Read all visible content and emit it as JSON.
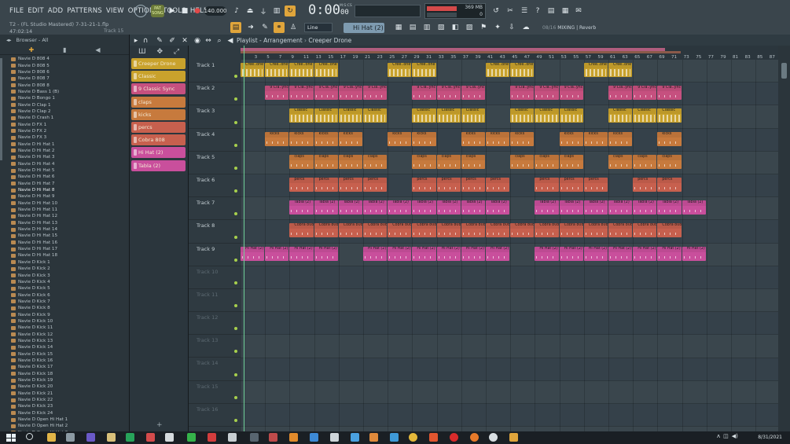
{
  "menu": [
    "FILE",
    "EDIT",
    "ADD",
    "PATTERNS",
    "VIEW",
    "OPTIONS",
    "TOOLS",
    "HELP"
  ],
  "song": {
    "title": "T2 - (FL Studio Mastered) 7-31-21-1.flp",
    "time": "47:02:14",
    "track": "Track 15"
  },
  "transport": {
    "pattern_song": [
      "PAT",
      "SONG"
    ],
    "tempo": "140.000",
    "time_main": "0:00",
    "time_frac": "00",
    "time_mode": "M:S:CS"
  },
  "cpu": {
    "ram": "369 MB",
    "poly": "0"
  },
  "toolbar": {
    "snap": "Line",
    "pattern": "Hi Hat (2)",
    "mixer_slot": "08/16",
    "mixer_label": "MIXING | Reverb"
  },
  "browser": {
    "title": "Browser - All",
    "files": [
      "Navie D 808 4",
      "Navie D 808 5",
      "Navie D 808 6",
      "Navie D 808 7",
      "Navie D 808 8",
      "Navie D Bass 1 (B)",
      "Navie D Bongo 1",
      "Navie D Clap 1",
      "Navie D Clap 2",
      "Navie D Crash 1",
      "Navie D FX 1",
      "Navie D FX 2",
      "Navie D FX 3",
      "Navie D Hi Hat 1",
      "Navie D Hi Hat 2",
      "Navie D Hi Hat 3",
      "Navie D Hi Hat 4",
      "Navie D Hi Hat 5",
      "Navie D Hi Hat 6",
      "Navie D Hi Hat 7",
      "Navie D Hi Hat 8",
      "Navie D Hi Hat 9",
      "Navie D Hi Hat 10",
      "Navie D Hi Hat 11",
      "Navie D Hi Hat 12",
      "Navie D Hi Hat 13",
      "Navie D Hi Hat 14",
      "Navie D Hi Hat 15",
      "Navie D Hi Hat 16",
      "Navie D Hi Hat 17",
      "Navie D Hi Hat 18",
      "Navie D Kick 1",
      "Navie D Kick 2",
      "Navie D Kick 3",
      "Navie D Kick 4",
      "Navie D Kick 5",
      "Navie D Kick 6",
      "Navie D Kick 7",
      "Navie D Kick 8",
      "Navie D Kick 9",
      "Navie D Kick 10",
      "Navie D Kick 11",
      "Navie D Kick 12",
      "Navie D Kick 13",
      "Navie D Kick 14",
      "Navie D Kick 15",
      "Navie D Kick 16",
      "Navie D Kick 17",
      "Navie D Kick 18",
      "Navie D Kick 19",
      "Navie D Kick 20",
      "Navie D Kick 21",
      "Navie D Kick 22",
      "Navie D Kick 23",
      "Navie D Kick 24",
      "Navie D Open Hi Hat 1",
      "Navie D Open Hi Hat 2",
      "Navie D Open Hi Hat 3"
    ],
    "selected": "Navie D Hi Hat 8"
  },
  "playlist": {
    "title": "Playlist - Arrangement",
    "current_pattern": "Creeper Drone",
    "patterns": [
      {
        "name": "Creeper Drone",
        "color": "#c9a22c"
      },
      {
        "name": "Classic",
        "color": "#c9a22c"
      },
      {
        "name": "9 Classic Sync",
        "color": "#c6507f"
      },
      {
        "name": "claps",
        "color": "#c77a3d"
      },
      {
        "name": "kicks",
        "color": "#c77a3d"
      },
      {
        "name": "percs",
        "color": "#c7604e"
      },
      {
        "name": "Cobra 808",
        "color": "#c7604e"
      },
      {
        "name": "Hi Hat (2)",
        "color": "#c94f9c"
      },
      {
        "name": "Tabla (2)",
        "color": "#c94f9c"
      }
    ],
    "tracks": [
      "Track 1",
      "Track 2",
      "Track 3",
      "Track 4",
      "Track 5",
      "Track 6",
      "Track 7",
      "Track 8",
      "Track 9",
      "Track 10",
      "Track 11",
      "Track 12",
      "Track 13",
      "Track 14",
      "Track 15",
      "Track 16"
    ],
    "ruler": [
      "3",
      "5",
      "7",
      "9",
      "11",
      "13",
      "15",
      "17",
      "19",
      "21",
      "23",
      "25",
      "27",
      "29",
      "31",
      "33",
      "35",
      "37",
      "39",
      "41",
      "43",
      "45",
      "47",
      "49",
      "51",
      "53",
      "55",
      "57",
      "59",
      "61",
      "63",
      "65",
      "67",
      "69",
      "71",
      "73",
      "75",
      "77",
      "79",
      "81",
      "83",
      "85",
      "87"
    ],
    "lanes": [
      {
        "label": "Cree..one",
        "color": "#c9a22c",
        "bars": [
          [
            1,
            4
          ],
          [
            5,
            8
          ],
          [
            9,
            12
          ],
          [
            13,
            16
          ],
          [
            25,
            28
          ],
          [
            29,
            32
          ],
          [
            41,
            44
          ],
          [
            45,
            48
          ],
          [
            57,
            60
          ],
          [
            61,
            64
          ]
        ]
      },
      {
        "label": "9 Cla..ync",
        "color": "#c6507f",
        "bars": [
          [
            5,
            8
          ],
          [
            9,
            12
          ],
          [
            13,
            16
          ],
          [
            17,
            20
          ],
          [
            21,
            24
          ],
          [
            29,
            32
          ],
          [
            33,
            36
          ],
          [
            37,
            40
          ],
          [
            45,
            48
          ],
          [
            49,
            52
          ],
          [
            53,
            56
          ],
          [
            61,
            64
          ],
          [
            65,
            68
          ],
          [
            69,
            72
          ]
        ]
      },
      {
        "label": "Classic",
        "color": "#c9a22c",
        "bars": [
          [
            9,
            12
          ],
          [
            13,
            16
          ],
          [
            17,
            20
          ],
          [
            21,
            24
          ],
          [
            29,
            32
          ],
          [
            33,
            36
          ],
          [
            37,
            40
          ],
          [
            45,
            48
          ],
          [
            49,
            52
          ],
          [
            53,
            56
          ],
          [
            61,
            64
          ],
          [
            65,
            68
          ],
          [
            69,
            72
          ]
        ]
      },
      {
        "label": "kicks",
        "color": "#c77a3d",
        "bars": [
          [
            5,
            8
          ],
          [
            9,
            12
          ],
          [
            13,
            16
          ],
          [
            17,
            20
          ],
          [
            25,
            28
          ],
          [
            29,
            32
          ],
          [
            37,
            40
          ],
          [
            41,
            44
          ],
          [
            45,
            48
          ],
          [
            53,
            56
          ],
          [
            57,
            60
          ],
          [
            61,
            64
          ],
          [
            69,
            72
          ]
        ]
      },
      {
        "label": "claps",
        "color": "#c77a3d",
        "bars": [
          [
            9,
            12
          ],
          [
            13,
            16
          ],
          [
            17,
            20
          ],
          [
            21,
            24
          ],
          [
            29,
            32
          ],
          [
            33,
            36
          ],
          [
            37,
            40
          ],
          [
            45,
            48
          ],
          [
            49,
            52
          ],
          [
            53,
            56
          ],
          [
            61,
            64
          ],
          [
            65,
            68
          ],
          [
            69,
            72
          ]
        ]
      },
      {
        "label": "percs",
        "color": "#c7604e",
        "bars": [
          [
            9,
            12
          ],
          [
            13,
            16
          ],
          [
            17,
            20
          ],
          [
            21,
            24
          ],
          [
            29,
            32
          ],
          [
            33,
            36
          ],
          [
            37,
            40
          ],
          [
            41,
            44
          ],
          [
            49,
            52
          ],
          [
            53,
            56
          ],
          [
            57,
            60
          ],
          [
            65,
            68
          ],
          [
            69,
            72
          ]
        ]
      },
      {
        "label": "Tabla (2)",
        "color": "#c94f9c",
        "bars": [
          [
            9,
            12
          ],
          [
            13,
            16
          ],
          [
            17,
            20
          ],
          [
            21,
            24
          ],
          [
            25,
            28
          ],
          [
            29,
            32
          ],
          [
            33,
            36
          ],
          [
            37,
            40
          ],
          [
            41,
            44
          ],
          [
            49,
            52
          ],
          [
            53,
            56
          ],
          [
            57,
            60
          ],
          [
            61,
            64
          ],
          [
            65,
            68
          ],
          [
            69,
            72
          ],
          [
            73,
            76
          ]
        ]
      },
      {
        "label": "Cobra 808",
        "color": "#c7604e",
        "bars": [
          [
            9,
            12
          ],
          [
            13,
            16
          ],
          [
            17,
            20
          ],
          [
            21,
            24
          ],
          [
            25,
            28
          ],
          [
            29,
            32
          ],
          [
            33,
            36
          ],
          [
            37,
            40
          ],
          [
            41,
            44
          ],
          [
            45,
            48
          ],
          [
            49,
            52
          ],
          [
            53,
            56
          ],
          [
            57,
            60
          ],
          [
            61,
            64
          ],
          [
            65,
            68
          ],
          [
            69,
            72
          ]
        ]
      },
      {
        "label": "Hi Hat (2)",
        "color": "#c94f9c",
        "bars": [
          [
            1,
            4
          ],
          [
            5,
            8
          ],
          [
            9,
            12
          ],
          [
            13,
            16
          ],
          [
            21,
            24
          ],
          [
            25,
            28
          ],
          [
            29,
            32
          ],
          [
            33,
            36
          ],
          [
            37,
            40
          ],
          [
            41,
            44
          ],
          [
            49,
            52
          ],
          [
            53,
            56
          ],
          [
            57,
            60
          ],
          [
            61,
            64
          ],
          [
            65,
            68
          ],
          [
            69,
            72
          ],
          [
            73,
            76
          ]
        ]
      }
    ]
  },
  "taskbar": {
    "date": "8/31/2021"
  },
  "colors": {
    "accent": "#e0a53b",
    "selection": "#7e9bb0",
    "play": "#6fcf97"
  }
}
